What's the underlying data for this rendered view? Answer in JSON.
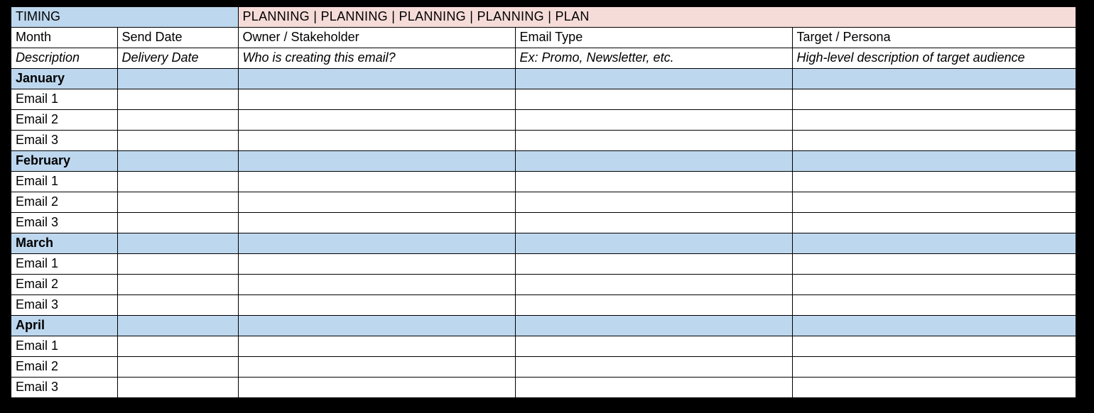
{
  "header": {
    "timing": "TIMING",
    "planning": "PLANNING  |  PLANNING  |  PLANNING  |  PLANNING  |  PLAN"
  },
  "columns": {
    "month": "Month",
    "send": "Send Date",
    "owner": "Owner / Stakeholder",
    "etype": "Email Type",
    "target": "Target / Persona"
  },
  "descriptions": {
    "month": "Description",
    "send": "Delivery Date",
    "owner": "Who is creating this email?",
    "etype": "Ex: Promo, Newsletter, etc.",
    "target": "High-level description of target audience"
  },
  "rows": {
    "jan": "January",
    "jan_e1": "Email 1",
    "jan_e2": "Email 2",
    "jan_e3": "Email 3",
    "feb": "February",
    "feb_e1": "Email 1",
    "feb_e2": "Email 2",
    "feb_e3": "Email 3",
    "mar": "March",
    "mar_e1": "Email 1",
    "mar_e2": "Email 2",
    "mar_e3": "Email 3",
    "apr": "April",
    "apr_e1": "Email 1",
    "apr_e2": "Email 2",
    "apr_e3": "Email 3"
  }
}
